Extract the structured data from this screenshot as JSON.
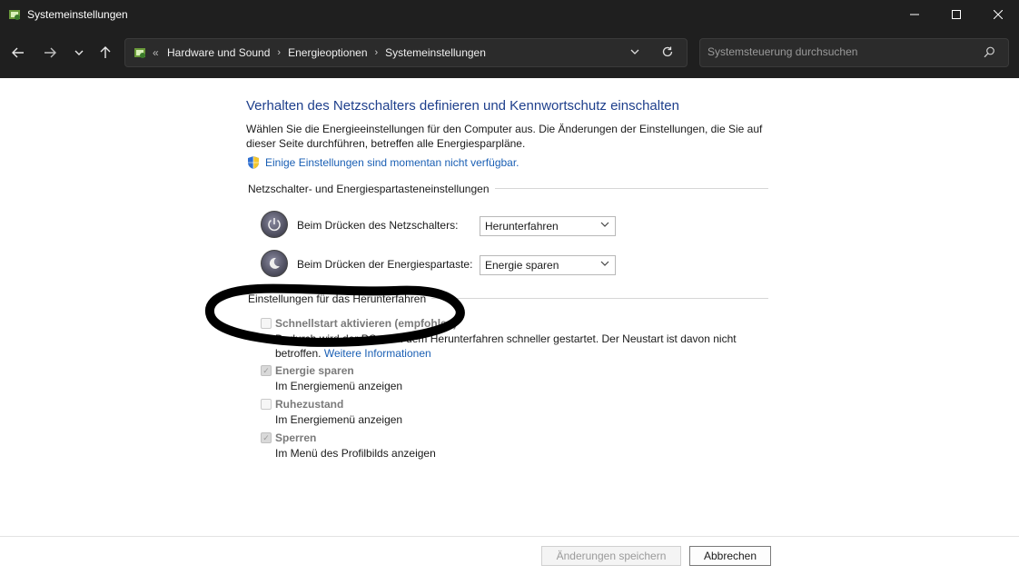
{
  "window": {
    "title": "Systemeinstellungen"
  },
  "nav": {
    "breadcrumbs": [
      "Hardware und Sound",
      "Energieoptionen",
      "Systemeinstellungen"
    ],
    "search_placeholder": "Systemsteuerung durchsuchen"
  },
  "main": {
    "heading": "Verhalten des Netzschalters definieren und Kennwortschutz einschalten",
    "description": "Wählen Sie die Energieeinstellungen für den Computer aus. Die Änderungen der Einstellungen, die Sie auf dieser Seite durchführen, betreffen alle Energiesparpläne.",
    "unavailable_link": "Einige Einstellungen sind momentan nicht verfügbar.",
    "power_section": {
      "title": "Netzschalter- und Energiespartasteneinstellungen",
      "rows": [
        {
          "label": "Beim Drücken des Netzschalters:",
          "value": "Herunterfahren"
        },
        {
          "label": "Beim Drücken der Energiespartaste:",
          "value": "Energie sparen"
        }
      ]
    },
    "shutdown_section": {
      "title": "Einstellungen für das Herunterfahren",
      "items": [
        {
          "title": "Schnellstart aktivieren (empfohlen)",
          "description": "Dadurch wird der PC nach dem Herunterfahren schneller gestartet. Der Neustart ist davon nicht",
          "description2": "betroffen.",
          "link": "Weitere Informationen",
          "checked": false
        },
        {
          "title": "Energie sparen",
          "description": "Im Energiemenü anzeigen",
          "checked": true
        },
        {
          "title": "Ruhezustand",
          "description": "Im Energiemenü anzeigen",
          "checked": false
        },
        {
          "title": "Sperren",
          "description": "Im Menü des Profilbilds anzeigen",
          "checked": true
        }
      ]
    }
  },
  "footer": {
    "save_label": "Änderungen speichern",
    "cancel_label": "Abbrechen"
  },
  "colors": {
    "title_bar": "#1f1f1f",
    "heading": "#1e3f8c",
    "link": "#1a5fb4"
  }
}
